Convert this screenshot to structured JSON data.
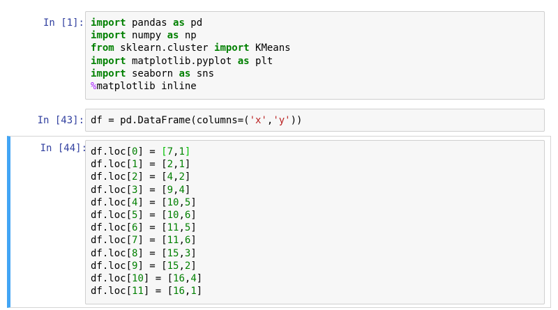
{
  "cells": [
    {
      "prompt": "In [1]:",
      "selected": false,
      "lines": [
        [
          {
            "t": "import",
            "c": "kw"
          },
          {
            "t": " pandas "
          },
          {
            "t": "as",
            "c": "kw"
          },
          {
            "t": " pd"
          }
        ],
        [
          {
            "t": "import",
            "c": "kw"
          },
          {
            "t": " numpy "
          },
          {
            "t": "as",
            "c": "kw"
          },
          {
            "t": " np"
          }
        ],
        [
          {
            "t": "from",
            "c": "kw"
          },
          {
            "t": " sklearn.cluster "
          },
          {
            "t": "import",
            "c": "kw"
          },
          {
            "t": " KMeans"
          }
        ],
        [
          {
            "t": "import",
            "c": "kw"
          },
          {
            "t": " matplotlib.pyplot "
          },
          {
            "t": "as",
            "c": "kw"
          },
          {
            "t": " plt"
          }
        ],
        [
          {
            "t": "import",
            "c": "kw"
          },
          {
            "t": " seaborn "
          },
          {
            "t": "as",
            "c": "kw"
          },
          {
            "t": " sns"
          }
        ],
        [
          {
            "t": "%",
            "c": "magic"
          },
          {
            "t": "matplotlib inline"
          }
        ]
      ]
    },
    {
      "prompt": "In [43]:",
      "selected": false,
      "lines": [
        [
          {
            "t": "df = pd.DataFrame(columns=("
          },
          {
            "t": "'x'",
            "c": "str"
          },
          {
            "t": ","
          },
          {
            "t": "'y'",
            "c": "str"
          },
          {
            "t": "))"
          }
        ]
      ]
    },
    {
      "prompt": "In [44]:",
      "selected": true,
      "lines": [
        [
          {
            "t": "df.loc["
          },
          {
            "t": "0",
            "c": "num"
          },
          {
            "t": "] = "
          },
          {
            "t": "[",
            "c": "bracket-hl"
          },
          {
            "t": "7",
            "c": "num"
          },
          {
            "t": ","
          },
          {
            "t": "1",
            "c": "num"
          },
          {
            "t": "]",
            "c": "bracket-hl"
          }
        ],
        [
          {
            "t": "df.loc["
          },
          {
            "t": "1",
            "c": "num"
          },
          {
            "t": "] = ["
          },
          {
            "t": "2",
            "c": "num"
          },
          {
            "t": ","
          },
          {
            "t": "1",
            "c": "num"
          },
          {
            "t": "]"
          }
        ],
        [
          {
            "t": "df.loc["
          },
          {
            "t": "2",
            "c": "num"
          },
          {
            "t": "] = ["
          },
          {
            "t": "4",
            "c": "num"
          },
          {
            "t": ","
          },
          {
            "t": "2",
            "c": "num"
          },
          {
            "t": "]"
          }
        ],
        [
          {
            "t": "df.loc["
          },
          {
            "t": "3",
            "c": "num"
          },
          {
            "t": "] = ["
          },
          {
            "t": "9",
            "c": "num"
          },
          {
            "t": ","
          },
          {
            "t": "4",
            "c": "num"
          },
          {
            "t": "]"
          }
        ],
        [
          {
            "t": "df.loc["
          },
          {
            "t": "4",
            "c": "num"
          },
          {
            "t": "] = ["
          },
          {
            "t": "10",
            "c": "num"
          },
          {
            "t": ","
          },
          {
            "t": "5",
            "c": "num"
          },
          {
            "t": "]"
          }
        ],
        [
          {
            "t": "df.loc["
          },
          {
            "t": "5",
            "c": "num"
          },
          {
            "t": "] = ["
          },
          {
            "t": "10",
            "c": "num"
          },
          {
            "t": ","
          },
          {
            "t": "6",
            "c": "num"
          },
          {
            "t": "]"
          }
        ],
        [
          {
            "t": "df.loc["
          },
          {
            "t": "6",
            "c": "num"
          },
          {
            "t": "] = ["
          },
          {
            "t": "11",
            "c": "num"
          },
          {
            "t": ","
          },
          {
            "t": "5",
            "c": "num"
          },
          {
            "t": "]"
          }
        ],
        [
          {
            "t": "df.loc["
          },
          {
            "t": "7",
            "c": "num"
          },
          {
            "t": "] = ["
          },
          {
            "t": "11",
            "c": "num"
          },
          {
            "t": ","
          },
          {
            "t": "6",
            "c": "num"
          },
          {
            "t": "]"
          }
        ],
        [
          {
            "t": "df.loc["
          },
          {
            "t": "8",
            "c": "num"
          },
          {
            "t": "] = ["
          },
          {
            "t": "15",
            "c": "num"
          },
          {
            "t": ","
          },
          {
            "t": "3",
            "c": "num"
          },
          {
            "t": "]"
          }
        ],
        [
          {
            "t": "df.loc["
          },
          {
            "t": "9",
            "c": "num"
          },
          {
            "t": "] = ["
          },
          {
            "t": "15",
            "c": "num"
          },
          {
            "t": ","
          },
          {
            "t": "2",
            "c": "num"
          },
          {
            "t": "]"
          }
        ],
        [
          {
            "t": "df.loc["
          },
          {
            "t": "10",
            "c": "num"
          },
          {
            "t": "] = ["
          },
          {
            "t": "16",
            "c": "num"
          },
          {
            "t": ","
          },
          {
            "t": "4",
            "c": "num"
          },
          {
            "t": "]"
          }
        ],
        [
          {
            "t": "df.loc["
          },
          {
            "t": "11",
            "c": "num"
          },
          {
            "t": "] = ["
          },
          {
            "t": "16",
            "c": "num"
          },
          {
            "t": ","
          },
          {
            "t": "1",
            "c": "num"
          },
          {
            "t": "]"
          }
        ]
      ]
    }
  ]
}
